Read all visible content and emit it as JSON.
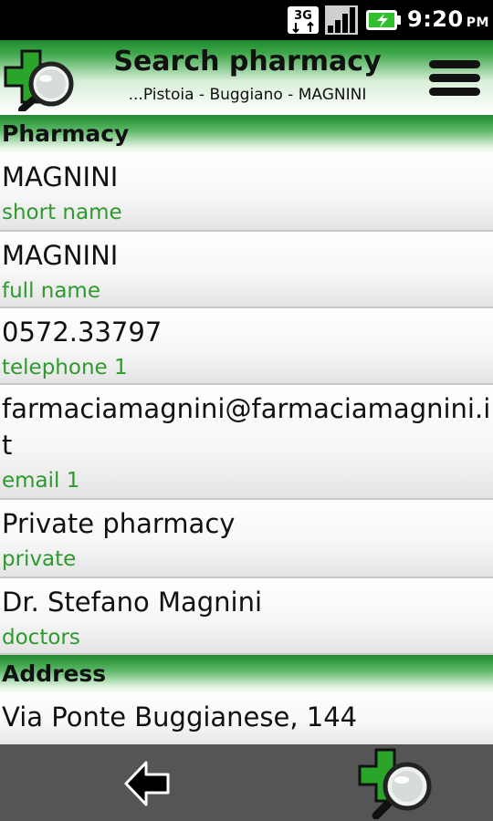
{
  "status_bar": {
    "network": "3G",
    "time": "9:20",
    "ampm": "PM"
  },
  "header": {
    "title": "Search pharmacy",
    "subtitle": "...Pistoia - Buggiano - MAGNINI"
  },
  "sections": {
    "pharmacy": "Pharmacy",
    "address": "Address"
  },
  "fields": {
    "short_name": {
      "value": "MAGNINI",
      "label": "short name"
    },
    "full_name": {
      "value": "MAGNINI",
      "label": "full name"
    },
    "telephone_1": {
      "value": "0572.33797",
      "label": "telephone 1"
    },
    "email_1": {
      "value": "farmaciamagnini@farmaciamagnini.it",
      "label": "email 1"
    },
    "private": {
      "value": "Private pharmacy",
      "label": "private"
    },
    "doctors": {
      "value": "Dr. Stefano Magnini",
      "label": "doctors"
    },
    "address": {
      "value": "Via Ponte Buggianese, 144"
    }
  },
  "colors": {
    "accent_green": "#2e9a2e",
    "header_green": "#1e8a2e",
    "bottom_bar": "#555555"
  },
  "icons": {
    "logo": "pharmacy-cross-magnifier-icon",
    "menu": "hamburger-menu-icon",
    "back": "back-arrow-icon",
    "search": "pharmacy-search-icon"
  }
}
